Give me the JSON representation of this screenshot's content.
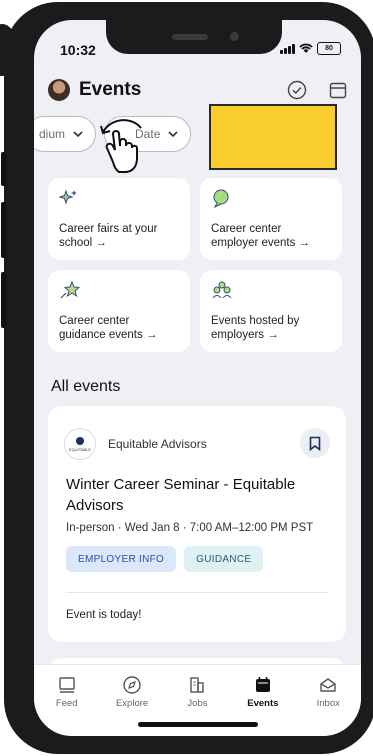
{
  "status_bar": {
    "time": "10:32",
    "battery": "80"
  },
  "header": {
    "title": "Events",
    "check_icon": "check-circle-icon",
    "calendar_icon": "calendar-icon"
  },
  "filters": [
    {
      "label": "dium"
    },
    {
      "label": "Date"
    }
  ],
  "categories": [
    {
      "label": "Career fairs at your school →",
      "icon": "sparkle-icon"
    },
    {
      "label": "Career center employer events →",
      "icon": "chat-bubble-icon"
    },
    {
      "label": "Career center guidance events →",
      "icon": "star-icon"
    },
    {
      "label": "Events hosted by employers →",
      "icon": "people-icon"
    }
  ],
  "section": {
    "title": "All events"
  },
  "event": {
    "org_name": "Equitable Advisors",
    "org_logo_text": "EQUITABLE",
    "title": "Winter Career Seminar - Equitable Advisors",
    "meta": "In-person · Wed Jan 8 · 7:00 AM–12:00 PM PST",
    "tags": [
      "EMPLOYER INFO",
      "GUIDANCE"
    ],
    "footer": "Event is today!"
  },
  "tabs": [
    {
      "label": "Feed",
      "icon": "feed-icon"
    },
    {
      "label": "Explore",
      "icon": "compass-icon"
    },
    {
      "label": "Jobs",
      "icon": "building-icon"
    },
    {
      "label": "Events",
      "icon": "calendar-filled-icon",
      "active": true
    },
    {
      "label": "Inbox",
      "icon": "inbox-icon"
    }
  ],
  "colors": {
    "highlight": "#f9cd2e",
    "accent": "#2f4ca8",
    "background": "#eef0f6"
  }
}
